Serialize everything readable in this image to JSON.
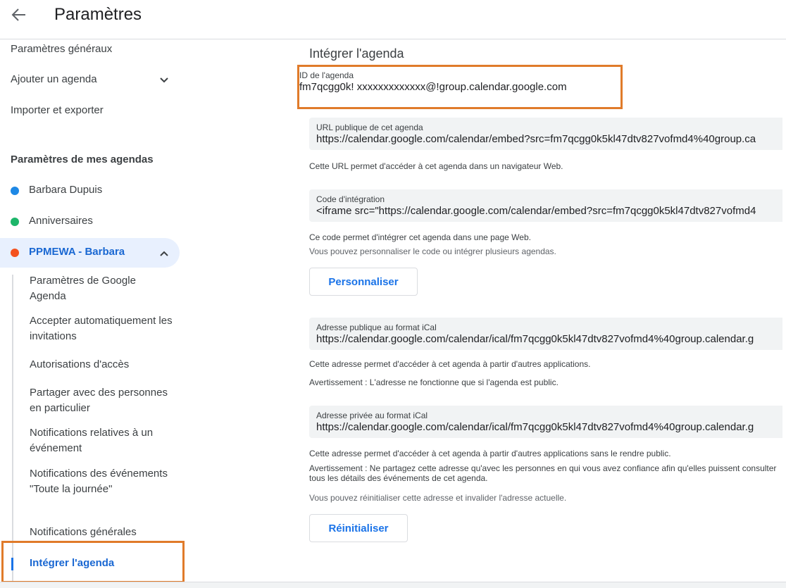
{
  "header": {
    "title": "Paramètres",
    "back_icon": "arrow-left-icon"
  },
  "sidebar": {
    "top_items": [
      "Paramètres généraux",
      "Ajouter un agenda",
      "Importer et exporter"
    ],
    "section_title": "Paramètres de mes agendas",
    "calendars": [
      {
        "name": "Barbara Dupuis",
        "color": "#1e88e5"
      },
      {
        "name": "Anniversaires",
        "color": "#1db66a"
      },
      {
        "name": "PPMEWA - Barbara",
        "color": "#f4511e"
      }
    ],
    "sub_items": [
      "Paramètres de Google Agenda",
      "Accepter automatiquement les invitations",
      "Autorisations d'accès",
      "Partager avec des personnes en particulier",
      "Notifications relatives à un événement",
      "Notifications des événements \"Toute la journée\"",
      "Notifications générales",
      "Intégrer l'agenda"
    ]
  },
  "main": {
    "title": "Intégrer l'agenda",
    "calendar_id": {
      "label": "ID de l'agenda",
      "value": "fm7qcgg0k! xxxxxxxxxxxxx@!group.calendar.google.com"
    },
    "public_url": {
      "label": "URL publique de cet agenda",
      "value": "https://calendar.google.com/calendar/embed?src=fm7qcgg0k5kl47dtv827vofmd4%40group.ca",
      "note": "Cette URL permet d'accéder à cet agenda dans un navigateur Web."
    },
    "embed_code": {
      "label": "Code d'intégration",
      "value": "<iframe src=\"https://calendar.google.com/calendar/embed?src=fm7qcgg0k5kl47dtv827vofmd4",
      "note1": "Ce code permet d'intégrer cet agenda dans une page Web.",
      "note2": "Vous pouvez personnaliser le code ou intégrer plusieurs agendas.",
      "button": "Personnaliser"
    },
    "ical_public": {
      "label": "Adresse publique au format iCal",
      "value": "https://calendar.google.com/calendar/ical/fm7qcgg0k5kl47dtv827vofmd4%40group.calendar.g",
      "note1": "Cette adresse permet d'accéder à cet agenda à partir d'autres applications.",
      "note2": "Avertissement : L'adresse ne fonctionne que si l'agenda est public."
    },
    "ical_private": {
      "label": "Adresse privée au format iCal",
      "value": "https://calendar.google.com/calendar/ical/fm7qcgg0k5kl47dtv827vofmd4%40group.calendar.g",
      "note1": "Cette adresse permet d'accéder à cet agenda à partir d'autres applications sans le rendre public.",
      "note2": "Avertissement : Ne partagez cette adresse qu'avec les personnes en qui vous avez confiance afin qu'elles puissent consulter tous les détails des événements de cet agenda.",
      "note3": "Vous pouvez réinitialiser cette adresse et invalider l'adresse actuelle.",
      "button": "Réinitialiser"
    }
  },
  "colors": {
    "accent": "#1a73e8",
    "highlight": "#e07b2a",
    "field_bg": "#f1f3f4"
  }
}
